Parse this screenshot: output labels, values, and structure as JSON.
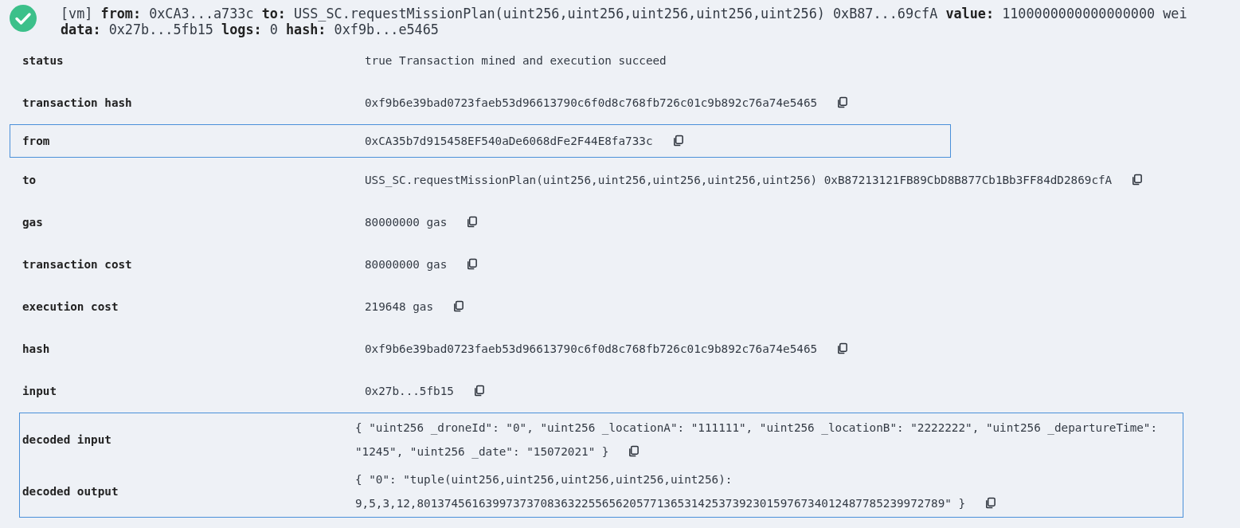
{
  "header": {
    "succeeded": true,
    "summary": "[vm] **from:** 0xCA3...a733c **to:** USS_SC.requestMissionPlan(uint256,uint256,uint256,uint256,uint256) 0xB87...69cfA **value:** 1100000000000000000 wei **data:** 0x27b...5fb15 **logs:** 0 **hash:** 0xf9b...e5465"
  },
  "sections": [
    {
      "highlighted": false,
      "rows": [
        {
          "label": "status",
          "value": "true Transaction mined and execution succeed",
          "copyable": false
        },
        {
          "label": "transaction hash",
          "value": "0xf9b6e39bad0723faeb53d96613790c6f0d8c768fb726c01c9b892c76a74e5465",
          "copyable": true
        }
      ]
    },
    {
      "highlighted": true,
      "rows": [
        {
          "label": "from",
          "value": "0xCA35b7d915458EF540aDe6068dFe2F44E8fa733c",
          "copyable": true
        }
      ]
    },
    {
      "highlighted": false,
      "rows": [
        {
          "label": "to",
          "value": "USS_SC.requestMissionPlan(uint256,uint256,uint256,uint256,uint256) 0xB87213121FB89CbD8B877Cb1Bb3FF84dD2869cfA",
          "copyable": true
        },
        {
          "label": "gas",
          "value": "80000000 gas",
          "copyable": true
        },
        {
          "label": "transaction cost",
          "value": "80000000 gas",
          "copyable": true
        },
        {
          "label": "execution cost",
          "value": "219648 gas",
          "copyable": true
        },
        {
          "label": "hash",
          "value": "0xf9b6e39bad0723faeb53d96613790c6f0d8c768fb726c01c9b892c76a74e5465",
          "copyable": true
        },
        {
          "label": "input",
          "value": "0x27b...5fb15",
          "copyable": true
        }
      ]
    },
    {
      "highlighted": true,
      "rows": [
        {
          "label": "decoded input",
          "value": "{ \"uint256 _droneId\": \"0\", \"uint256 _locationA\": \"111111\", \"uint256 _locationB\": \"2222222\", \"uint256 _departureTime\": \"1245\", \"uint256 _date\": \"15072021\" }",
          "copyable": true
        },
        {
          "label": "decoded output",
          "value": "{ \"0\": \"tuple(uint256,uint256,uint256,uint256,uint256): 9,5,3,12,80137456163997373708363225565620577136531425373923015976734012487785239972789\" }",
          "copyable": true
        }
      ]
    }
  ]
}
